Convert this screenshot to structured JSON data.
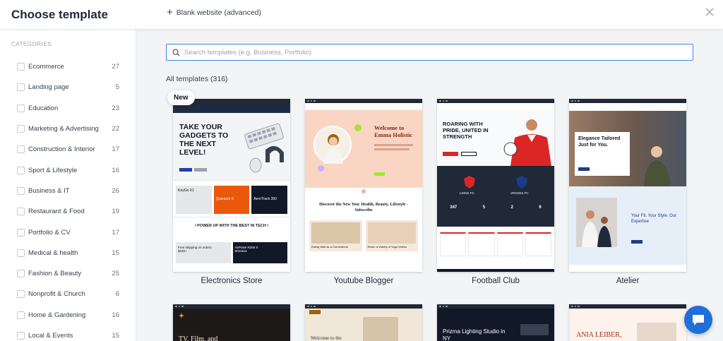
{
  "header": {
    "title": "Choose template",
    "blank_label": "Blank website (advanced)"
  },
  "sidebar": {
    "heading": "CATEGORIES",
    "items": [
      {
        "label": "Ecommerce",
        "count": "27"
      },
      {
        "label": "Landing page",
        "count": "5"
      },
      {
        "label": "Education",
        "count": "23"
      },
      {
        "label": "Marketing & Advertising",
        "count": "22"
      },
      {
        "label": "Construction & Interior",
        "count": "17"
      },
      {
        "label": "Sport & Lifestyle",
        "count": "16"
      },
      {
        "label": "Business & IT",
        "count": "26"
      },
      {
        "label": "Restaurant & Food",
        "count": "19"
      },
      {
        "label": "Portfolio & CV",
        "count": "17"
      },
      {
        "label": "Medical & health",
        "count": "15"
      },
      {
        "label": "Fashion & Beauty",
        "count": "25"
      },
      {
        "label": "Nonprofit & Church",
        "count": "6"
      },
      {
        "label": "Home & Gardening",
        "count": "16"
      },
      {
        "label": "Local & Events",
        "count": "15"
      }
    ]
  },
  "search": {
    "placeholder": "Search templates (e.g. Business, Portfolio)",
    "value": ""
  },
  "templates": {
    "heading": "All templates (316)",
    "new_badge": "New",
    "cards": [
      {
        "name": "Electronics Store",
        "hero": "TAKE YOUR GADGETS TO THE NEXT LEVEL!",
        "sub1": "KeyGo X1",
        "sub2": "Quantum X",
        "sub3": "AeroTrack 300",
        "band": "/ POWER UP WITH THE BEST IN TECH /",
        "promo1": "Free shipping on orders $100+",
        "promo2": "AirPulse R255 X Wireless"
      },
      {
        "name": "Youtube Blogger",
        "hero": "Welcome to Emma Holistic",
        "band": "Discover the New You: Health, Beauty, Lifestyle - Subscribe",
        "c1": "Eating Well as a Cornerstone",
        "c2": "Relax: a Variety of Yoga Videos"
      },
      {
        "name": "Football Club",
        "hero": "ROARING WITH PRIDE, UNITED IN STRENGTH",
        "team1": "LIONS FC",
        "team2": "VIKINGS FC",
        "stats": [
          "347",
          "5",
          "2",
          "6"
        ]
      },
      {
        "name": "Atelier",
        "hero": "Elegance Tailored Just for You.",
        "band": "Your Fit. Your Style. Our Expertise"
      }
    ],
    "row2": [
      {
        "hero": "TV, Film, and"
      },
      {
        "hero": "Welcome to the"
      },
      {
        "hero": "Prizma Lighting Studio in NY"
      },
      {
        "hero": "ANIA LEIBER,"
      }
    ]
  },
  "colors": {
    "accent": "#3b82f6",
    "chat": "#1e6fd9",
    "orange": "#f59e0b",
    "red": "#dc2626"
  }
}
